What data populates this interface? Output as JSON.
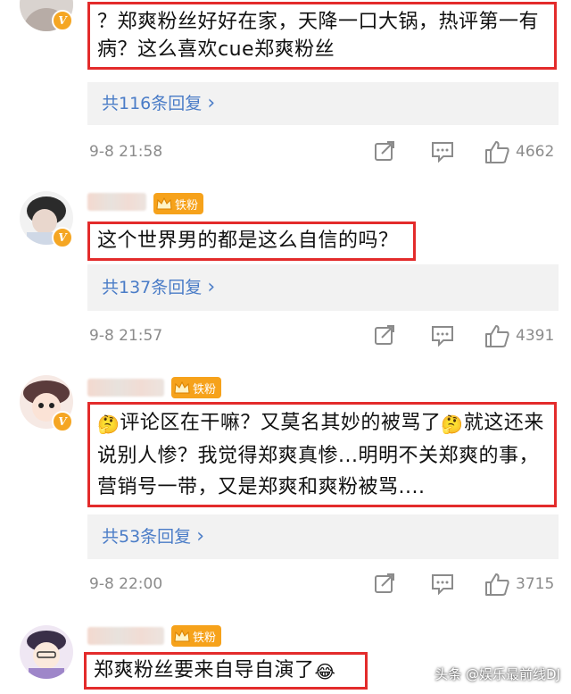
{
  "comments": [
    {
      "text": "？郑爽粉丝好好在家，天降一口大锅，热评第一有病？这么喜欢cue郑爽粉丝",
      "replies": "共116条回复",
      "time": "9-8 21:58",
      "likes": "4662"
    },
    {
      "fan_badge": "铁粉",
      "text": "这个世界男的都是这么自信的吗？",
      "replies": "共137条回复",
      "time": "9-8 21:57",
      "likes": "4391"
    },
    {
      "fan_badge": "铁粉",
      "text_a": "评论区在干嘛？又莫名其妙的被骂了",
      "text_b": "就这还来说别人惨？我觉得郑爽真惨...明明不关郑爽的事，营销号一带，又是郑爽和爽粉被骂....",
      "replies": "共53条回复",
      "time": "9-8 22:00",
      "likes": "3715"
    },
    {
      "fan_badge": "铁粉",
      "text": "郑爽粉丝要来自导自演了"
    }
  ],
  "chevron": "›",
  "icons": {
    "share": "share-icon",
    "comment": "comment-icon",
    "like": "thumbs-up-icon",
    "verified": "verified-v-icon",
    "emoji_thinking": "thinking-face-emoji",
    "emoji_laugh": "laughing-face-emoji"
  },
  "colors": {
    "highlight_border": "#e32b2b",
    "reply_link": "#4a7cc7",
    "fan_badge": "#f6a21b",
    "meta": "#8b8b8b"
  },
  "watermark": {
    "prefix": "头条",
    "handle": "@娱乐最前线DJ"
  }
}
